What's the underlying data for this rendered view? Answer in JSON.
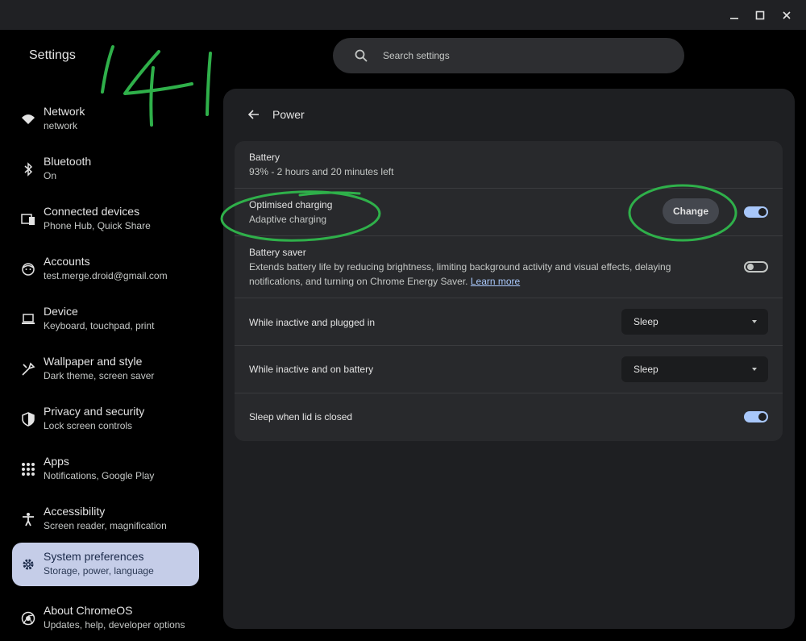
{
  "window": {
    "controls": [
      {
        "name": "minimize-icon"
      },
      {
        "name": "maximize-icon"
      },
      {
        "name": "close-icon"
      }
    ]
  },
  "app": {
    "title": "Settings"
  },
  "search": {
    "placeholder": "Search settings",
    "icon": "search-icon"
  },
  "sidebar": {
    "items": [
      {
        "label": "Network",
        "sub": "network",
        "icon": "wifi-icon"
      },
      {
        "label": "Bluetooth",
        "sub": "On",
        "icon": "bluetooth-icon"
      },
      {
        "label": "Connected devices",
        "sub": "Phone Hub, Quick Share",
        "icon": "connected-devices-icon"
      },
      {
        "label": "Accounts",
        "sub": "test.merge.droid@gmail.com",
        "icon": "account-icon"
      },
      {
        "label": "Device",
        "sub": "Keyboard, touchpad, print",
        "icon": "laptop-icon"
      },
      {
        "label": "Wallpaper and style",
        "sub": "Dark theme, screen saver",
        "icon": "palette-icon"
      },
      {
        "label": "Privacy and security",
        "sub": "Lock screen controls",
        "icon": "shield-icon"
      },
      {
        "label": "Apps",
        "sub": "Notifications, Google Play",
        "icon": "apps-grid-icon"
      },
      {
        "label": "Accessibility",
        "sub": "Screen reader, magnification",
        "icon": "accessibility-icon"
      },
      {
        "label": "System preferences",
        "sub": "Storage, power, language",
        "icon": "gear-icon",
        "active": true
      },
      {
        "label": "About ChromeOS",
        "sub": "Updates, help, developer options",
        "icon": "chrome-icon"
      }
    ]
  },
  "page": {
    "title": "Power",
    "back_icon": "back-arrow-icon"
  },
  "power": {
    "battery": {
      "title": "Battery",
      "status": "93% - 2 hours and 20 minutes left"
    },
    "optimised_charging": {
      "title": "Optimised charging",
      "sub": "Adaptive charging",
      "button": "Change",
      "enabled": true
    },
    "battery_saver": {
      "title": "Battery saver",
      "desc": "Extends battery life by reducing brightness, limiting background activity and visual effects, delaying notifications, and turning on Chrome Energy Saver.",
      "link": "Learn more",
      "enabled": false
    },
    "inactive_plugged": {
      "label": "While inactive and plugged in",
      "value": "Sleep"
    },
    "inactive_battery": {
      "label": "While inactive and on battery",
      "value": "Sleep"
    },
    "lid_closed": {
      "label": "Sleep when lid is closed",
      "enabled": true
    }
  },
  "annotations": {
    "handwritten_number": "141",
    "stroke_color": "#2fb04a"
  },
  "colors": {
    "accent": "#a8c7fa",
    "active_nav": "#c5cde8",
    "background": "#000000",
    "surface": "#1e1f22",
    "card": "#28292c"
  }
}
